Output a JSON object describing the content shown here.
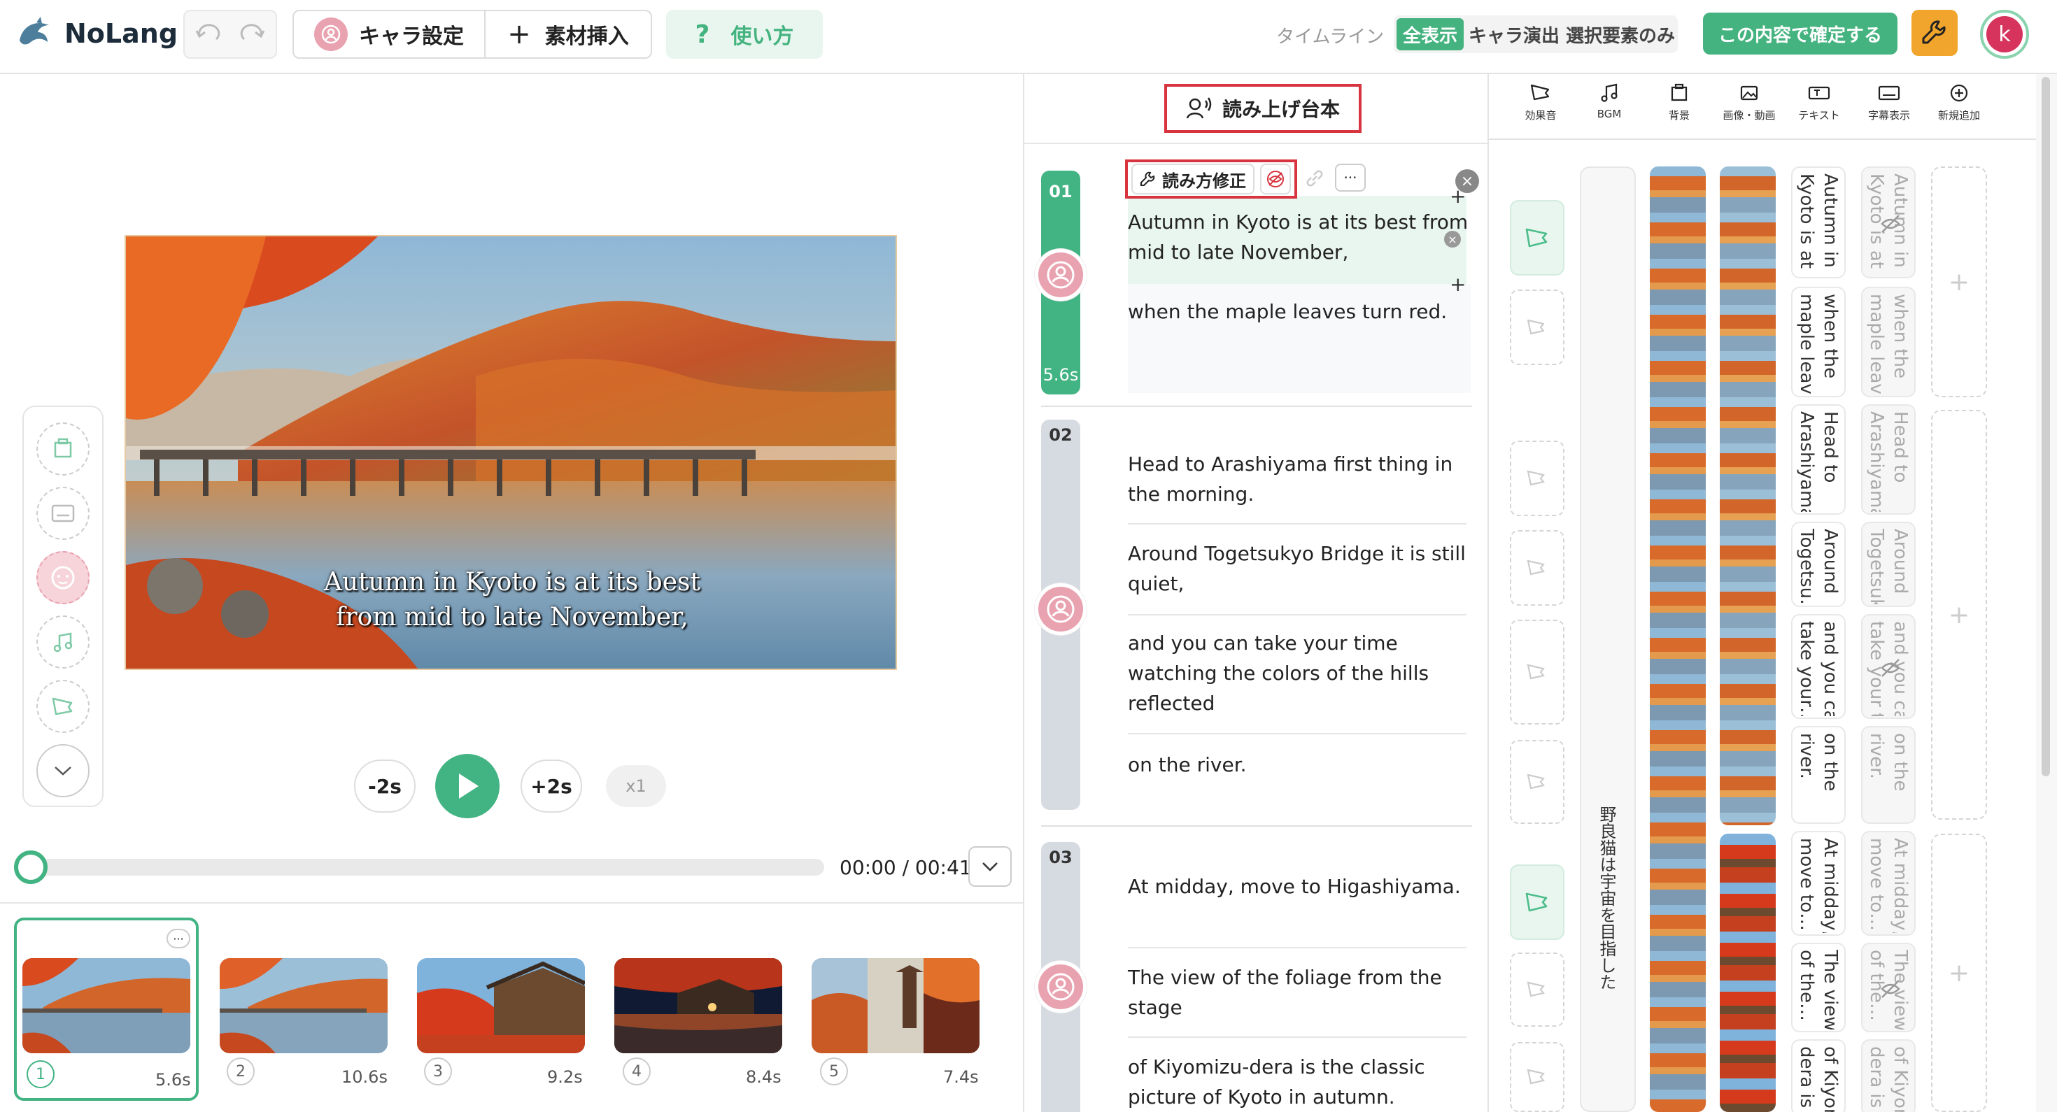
{
  "app": {
    "name": "NoLang"
  },
  "toolbar": {
    "chara": "キャラ設定",
    "insert": "素材挿入",
    "howto": "使い方"
  },
  "timeline": {
    "label": "タイムライン",
    "view_all": "全表示",
    "view_chara": "キャラ演出",
    "view_selected": "選択要素のみ"
  },
  "confirm": "この内容で確定する",
  "user": {
    "initial": "k"
  },
  "preview": {
    "subtitle1": "Autumn in Kyoto is at its best",
    "subtitle2": "from mid to late November,"
  },
  "player": {
    "back": "-2s",
    "fwd": "+2s",
    "speed": "x1",
    "time": "00:00 / 00:41"
  },
  "thumbs": [
    {
      "num": "1",
      "dur": "5.6s"
    },
    {
      "num": "2",
      "dur": "10.6s"
    },
    {
      "num": "3",
      "dur": "9.2s"
    },
    {
      "num": "4",
      "dur": "8.4s"
    },
    {
      "num": "5",
      "dur": "7.4s"
    }
  ],
  "script": {
    "title": "読み上げ台本",
    "fix_reading": "読み方修正",
    "more": "···",
    "segments": [
      {
        "num": "01",
        "dur": "5.6s",
        "lines": [
          "Autumn in Kyoto is at its best from mid to late November,",
          "when the maple leaves turn red."
        ]
      },
      {
        "num": "02",
        "lines": [
          "Head to Arashiyama first thing in the morning.",
          "Around Togetsukyo Bridge it is still quiet,",
          "and you can take your time watching the colors of the hills reflected",
          "on the river."
        ]
      },
      {
        "num": "03",
        "lines": [
          "At midday, move to Higashiyama.",
          "The view of the foliage from the stage",
          "of Kiyomizu-dera is the classic picture of Kyoto in autumn."
        ]
      }
    ]
  },
  "tracks": {
    "headers": [
      "効果音",
      "BGM",
      "背景",
      "画像・動画",
      "テキスト",
      "字幕表示",
      "新規追加"
    ],
    "bgm_title": "野良猫は宇宙を目指した",
    "text_cells": [
      [
        "Autumn in",
        "Kyoto is at i…"
      ],
      [
        "when the",
        "maple leav…"
      ],
      [
        "Head to",
        "Arashiyama…"
      ],
      [
        "Around",
        "Togetsu…"
      ],
      [
        "and you can",
        "take your…"
      ],
      [
        "on the",
        "river."
      ],
      [
        "At midday,",
        "move to…"
      ],
      [
        "The view",
        "of the…"
      ],
      [
        "of Kiyomi",
        "dera is th"
      ]
    ],
    "sub_cells": [
      [
        "Autumn in",
        "Kyoto is at i…"
      ],
      [
        "when the",
        "maple leave…"
      ],
      [
        "Head to",
        "Arashiyama…"
      ],
      [
        "Around",
        "Togetsuk…"
      ],
      [
        "and you can",
        "take your ti…"
      ],
      [
        "on the",
        "river."
      ],
      [
        "At midday,",
        "move to…"
      ],
      [
        "The view",
        "of the…"
      ],
      [
        "of Kiyomi",
        "dera is the"
      ]
    ]
  }
}
